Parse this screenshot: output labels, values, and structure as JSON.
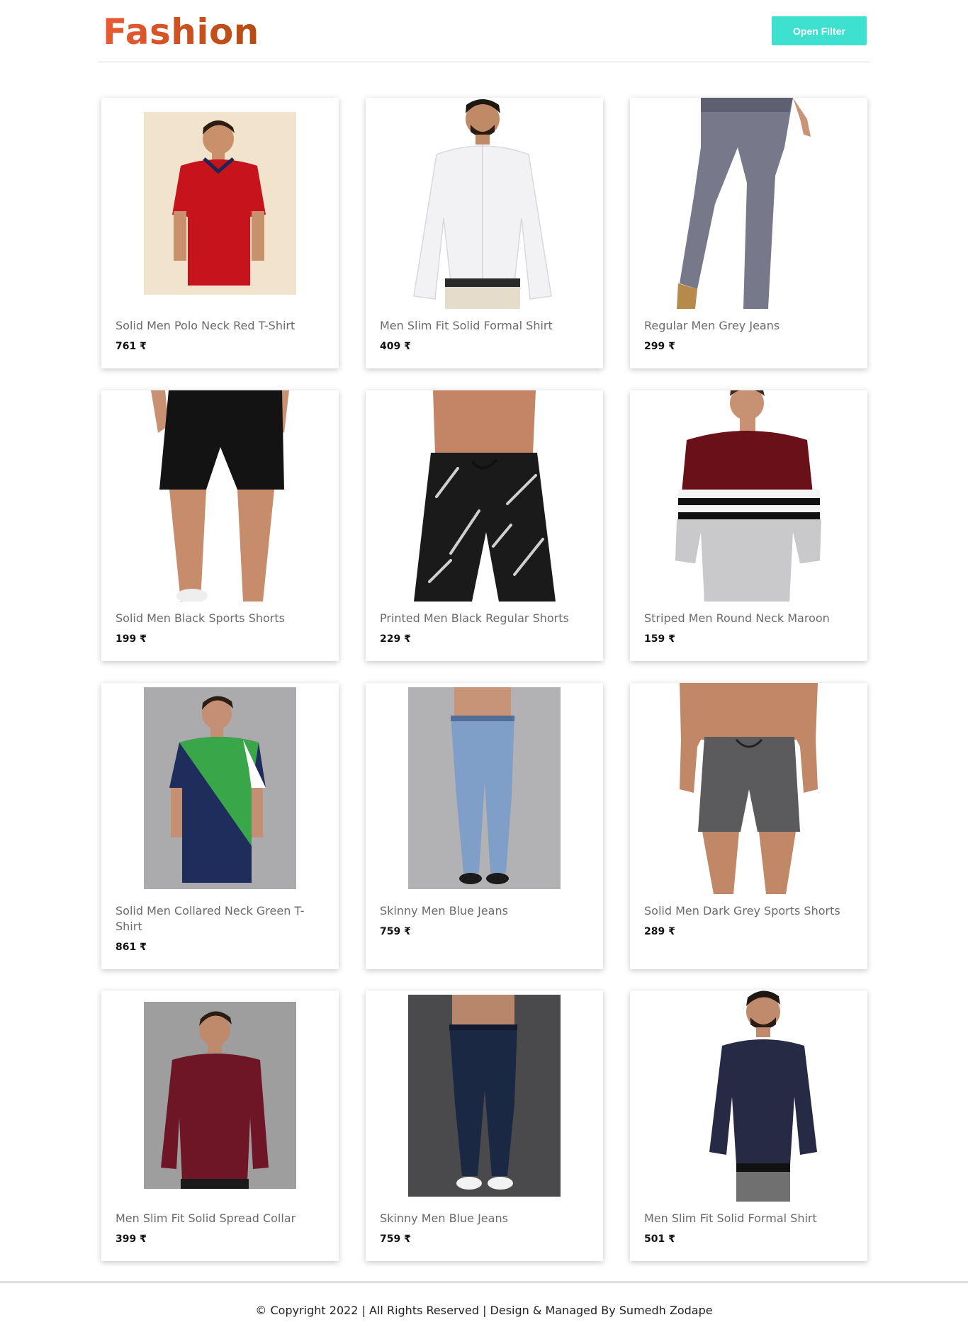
{
  "header": {
    "brand": "Fashion",
    "filter_button": "Open Filter"
  },
  "products": [
    {
      "name": "Solid Men Polo Neck Red T-Shirt",
      "price": "761 ₹"
    },
    {
      "name": "Men Slim Fit Solid Formal Shirt",
      "price": "409 ₹"
    },
    {
      "name": "Regular Men Grey Jeans",
      "price": "299 ₹"
    },
    {
      "name": "Solid Men Black Sports Shorts",
      "price": "199 ₹"
    },
    {
      "name": "Printed Men Black Regular Shorts",
      "price": "229 ₹"
    },
    {
      "name": "Striped Men Round Neck Maroon",
      "price": "159 ₹"
    },
    {
      "name": "Solid Men Collared Neck Green T-Shirt",
      "price": "861 ₹"
    },
    {
      "name": "Skinny Men Blue Jeans",
      "price": "759 ₹"
    },
    {
      "name": "Solid Men Dark Grey Sports Shorts",
      "price": "289 ₹"
    },
    {
      "name": "Men Slim Fit Solid Spread Collar",
      "price": "399 ₹"
    },
    {
      "name": "Skinny Men Blue Jeans",
      "price": "759 ₹"
    },
    {
      "name": "Men Slim Fit Solid Formal Shirt",
      "price": "501 ₹"
    }
  ],
  "footer": {
    "copyright": "© Copyright 2022 | All Rights Reserved | Design & Managed By Sumedh Zodape"
  },
  "colors": {
    "accent": "#3ee0d0",
    "brand": "#d9572b"
  }
}
